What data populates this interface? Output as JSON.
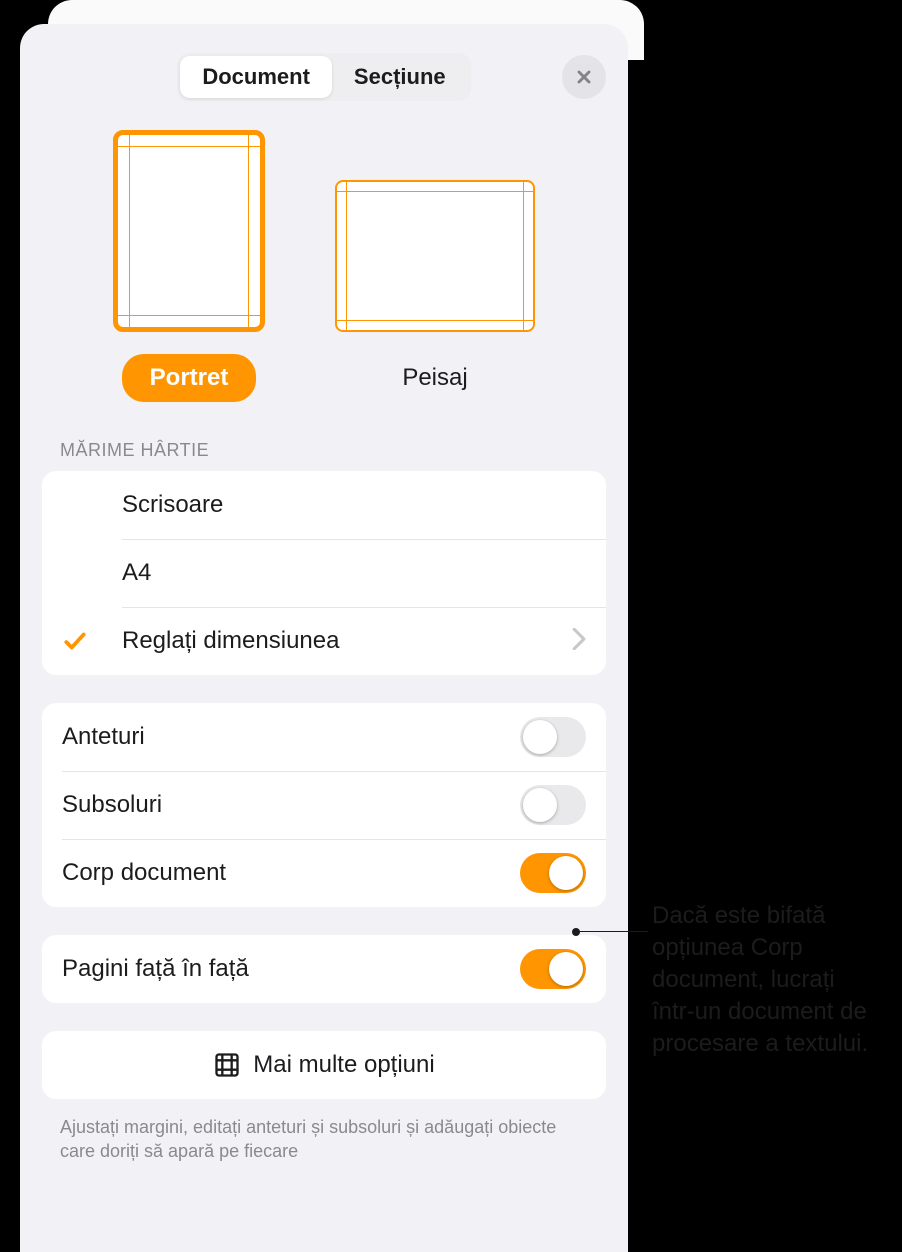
{
  "tabs": {
    "document": "Document",
    "section": "Secțiune"
  },
  "orientation": {
    "portrait": "Portret",
    "landscape": "Peisaj"
  },
  "paper_size": {
    "title": "Mărime hârtie",
    "letter": "Scrisoare",
    "a4": "A4",
    "custom": "Reglați dimensiunea"
  },
  "toggles": {
    "headers": "Anteturi",
    "footers": "Subsoluri",
    "body": "Corp document",
    "facing": "Pagini față în față"
  },
  "more_options": "Mai multe opțiuni",
  "footer_note": "Ajustați margini, editați anteturi și subsoluri și adăugați obiecte care doriți să apară pe fiecare",
  "callout": "Dacă este bifată opțiunea Corp document, lucrați într-un document de procesare a textului."
}
